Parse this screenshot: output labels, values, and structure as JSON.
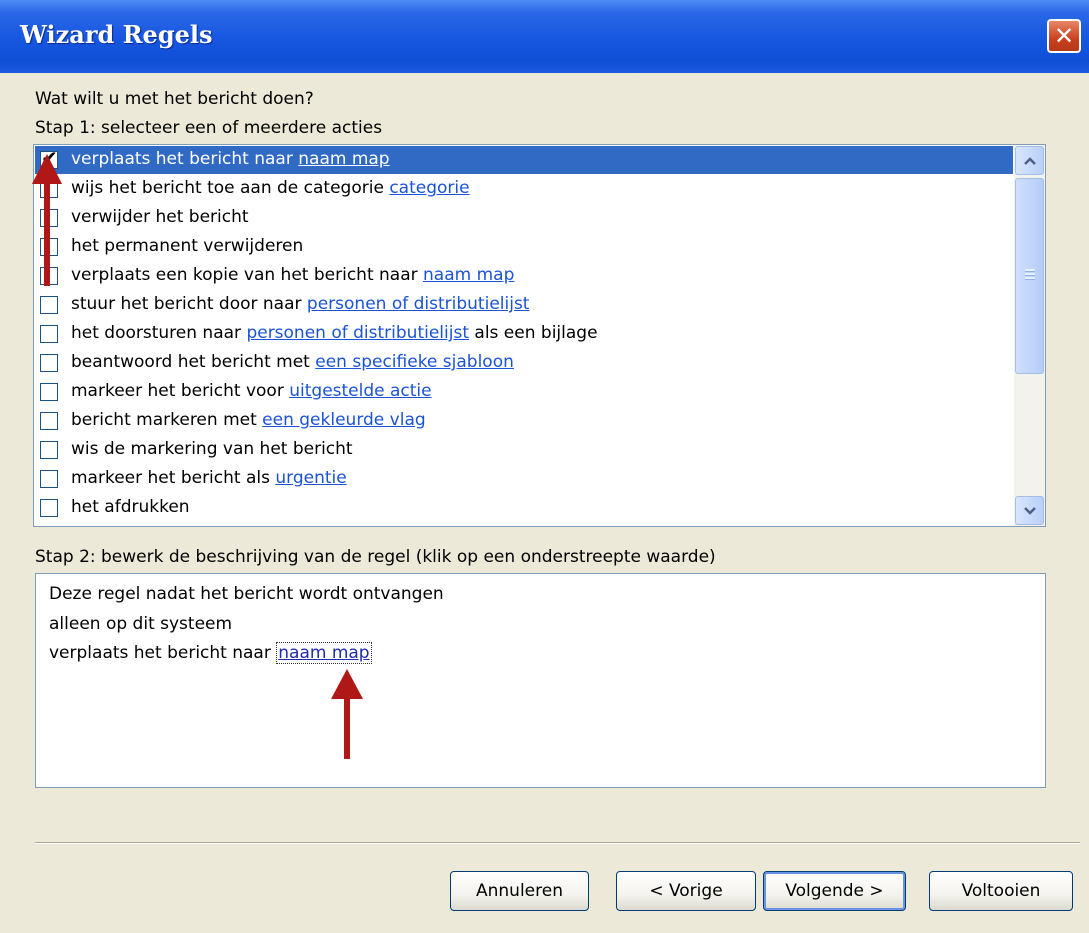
{
  "window": {
    "title": "Wizard Regels",
    "close_glyph": "✕"
  },
  "question": "Wat wilt u met het bericht doen?",
  "step1_label": "Stap 1: selecteer een of meerdere acties",
  "actions": [
    {
      "checked": true,
      "selected": true,
      "text": "verplaats het bericht naar ",
      "link": "naam map",
      "suffix": ""
    },
    {
      "checked": false,
      "selected": false,
      "text": "wijs het bericht toe aan de categorie ",
      "link": "categorie",
      "suffix": ""
    },
    {
      "checked": false,
      "selected": false,
      "text": "verwijder het bericht",
      "link": "",
      "suffix": ""
    },
    {
      "checked": false,
      "selected": false,
      "text": "het permanent verwijderen",
      "link": "",
      "suffix": ""
    },
    {
      "checked": false,
      "selected": false,
      "text": "verplaats een kopie van het bericht naar ",
      "link": "naam map",
      "suffix": ""
    },
    {
      "checked": false,
      "selected": false,
      "text": "stuur het bericht door naar ",
      "link": "personen of distributielijst",
      "suffix": ""
    },
    {
      "checked": false,
      "selected": false,
      "text": "het doorsturen naar ",
      "link": "personen of distributielijst",
      "suffix": " als een bijlage"
    },
    {
      "checked": false,
      "selected": false,
      "text": "beantwoord het bericht met ",
      "link": "een specifieke sjabloon",
      "suffix": ""
    },
    {
      "checked": false,
      "selected": false,
      "text": "markeer het bericht voor ",
      "link": "uitgestelde actie",
      "suffix": ""
    },
    {
      "checked": false,
      "selected": false,
      "text": "bericht markeren met ",
      "link": "een gekleurde vlag",
      "suffix": ""
    },
    {
      "checked": false,
      "selected": false,
      "text": "wis de markering van het bericht",
      "link": "",
      "suffix": ""
    },
    {
      "checked": false,
      "selected": false,
      "text": "markeer het bericht als ",
      "link": "urgentie",
      "suffix": ""
    },
    {
      "checked": false,
      "selected": false,
      "text": "het afdrukken",
      "link": "",
      "suffix": ""
    }
  ],
  "step2_label": "Stap 2: bewerk de beschrijving van de regel (klik op een onderstreepte waarde)",
  "description": {
    "line1": "Deze regel nadat het bericht wordt ontvangen",
    "line2": "alleen op dit systeem",
    "line3_prefix": "verplaats het bericht naar ",
    "line3_link": "naam map"
  },
  "buttons": {
    "cancel": "Annuleren",
    "back": "< Vorige",
    "next": "Volgende >",
    "finish": "Voltooien"
  },
  "colors": {
    "selection": "#316ac5",
    "link": "#1a53d6",
    "annotation_arrow": "#b01717"
  }
}
